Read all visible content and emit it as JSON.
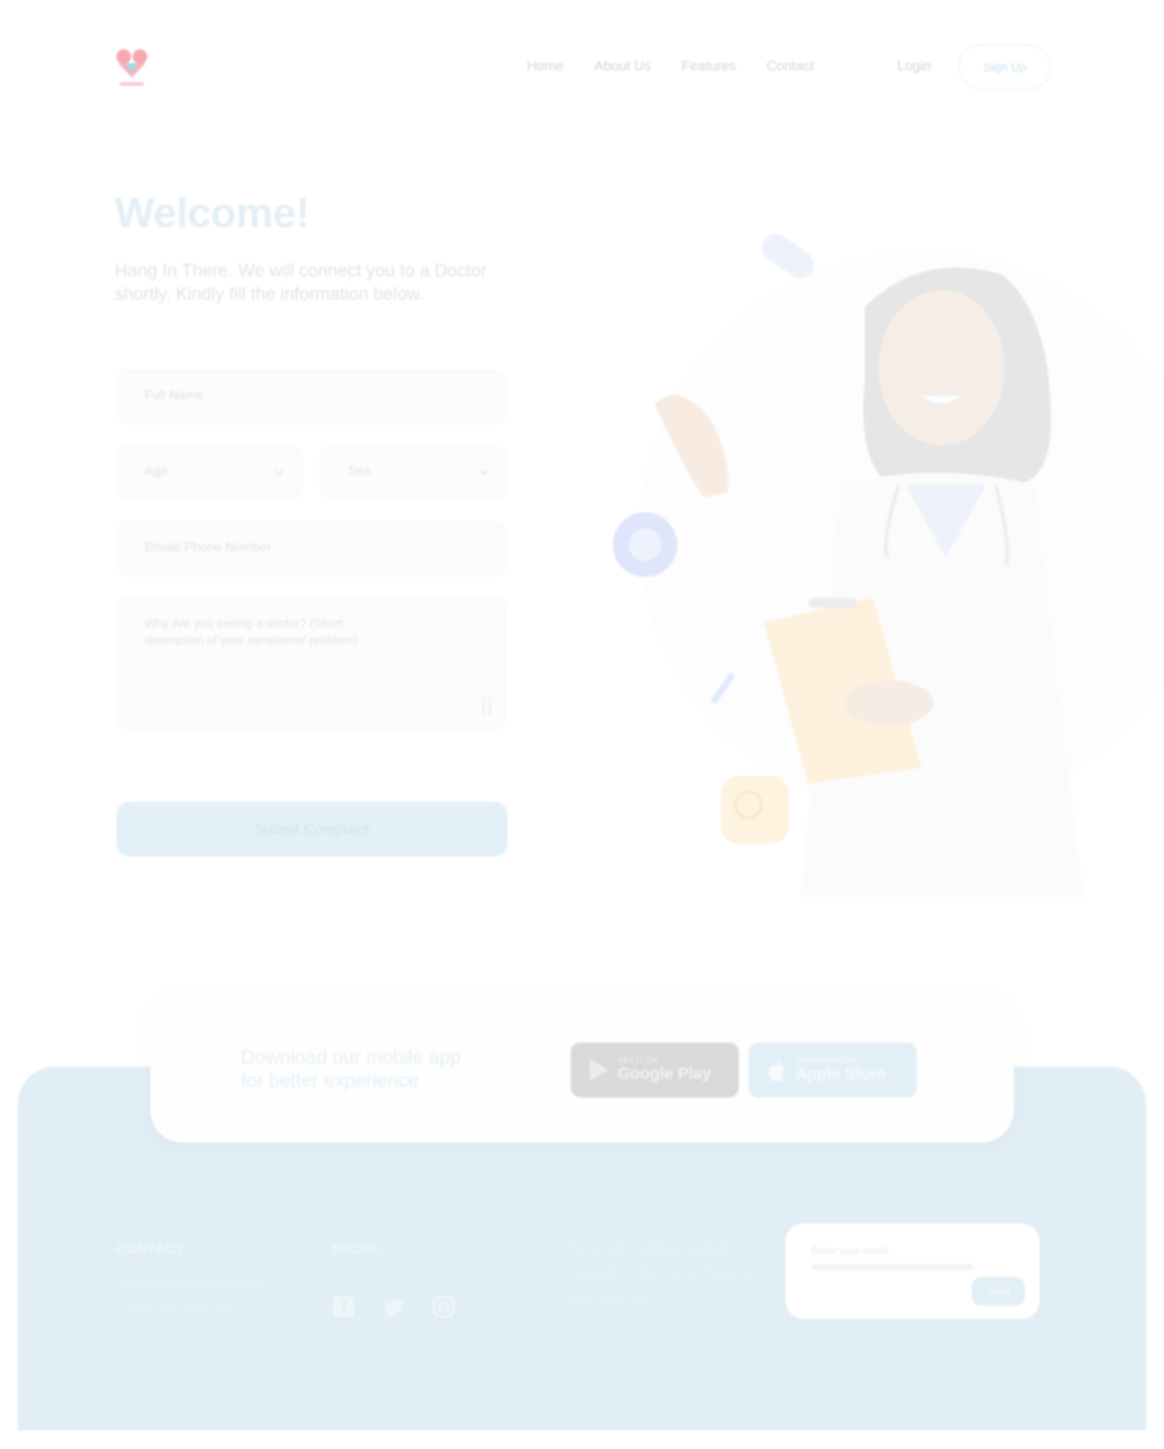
{
  "header": {
    "nav": [
      "Home",
      "About Us",
      "Features",
      "Contact"
    ],
    "login_label": "Login",
    "signup_label": "Sign Up"
  },
  "hero": {
    "title": "Welcome!",
    "intro": "Hang In There. We will connect you to a Doctor shortly. Kindly fill the information below."
  },
  "form": {
    "full_name_placeholder": "Full Name",
    "age_placeholder": "Age",
    "sex_placeholder": "Sex",
    "email_placeholder": "Email/ Phone Number",
    "symptoms_placeholder": "Why Are you seeing a doctor? (Short description of your symptoms/ problem)",
    "submit_label": "Submit Complaint"
  },
  "app_banner": {
    "text": "Download our mobile app for better experience",
    "google": {
      "small": "GET IT ON",
      "big": "Google Play"
    },
    "apple": {
      "small": "Download on the",
      "big": "Apple Store"
    }
  },
  "footer": {
    "contact_heading": "CONTACT",
    "contact_email": "hello@doctorfinder.com",
    "contact_phone": "(+234) 81 2345 78",
    "social_heading": "SOCIAL",
    "copyright": "Terms and Conditions applied. Copyright © 2022 Doctor Finder. All rights reserved.",
    "newsletter_placeholder": "Enter your email",
    "newsletter_button": "Send"
  },
  "colors": {
    "accent_light": "#e1eef5",
    "logo_red": "#f28b93",
    "logo_teal": "#7fd3dc"
  }
}
